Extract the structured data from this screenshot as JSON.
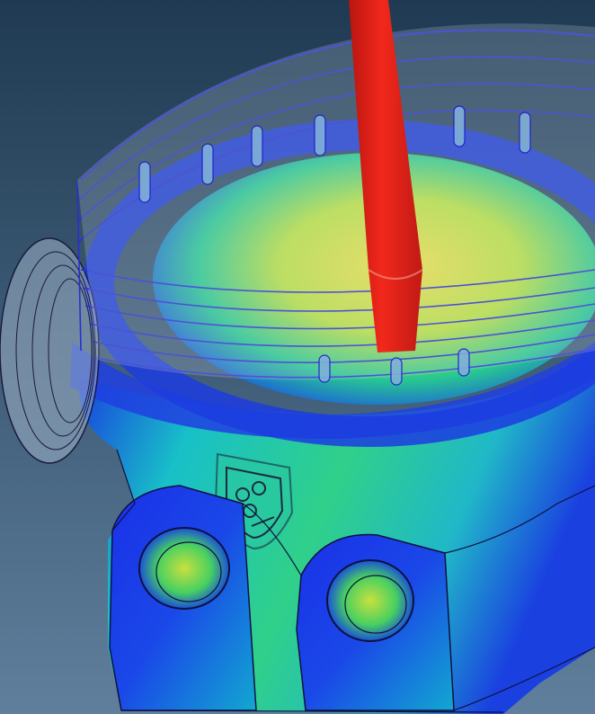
{
  "scene": {
    "subject": "cast-housing-fill-simulation-render",
    "icons": [
      "crest-emblem-icon"
    ],
    "colors": {
      "background_top": "#1f3a52",
      "background_bottom": "#5f7f9c",
      "wireframe": "#2a2fd0",
      "sprue": "#e8211c",
      "cold": "#1030e0",
      "mid": "#10c8a0",
      "warm": "#e8e040"
    }
  }
}
